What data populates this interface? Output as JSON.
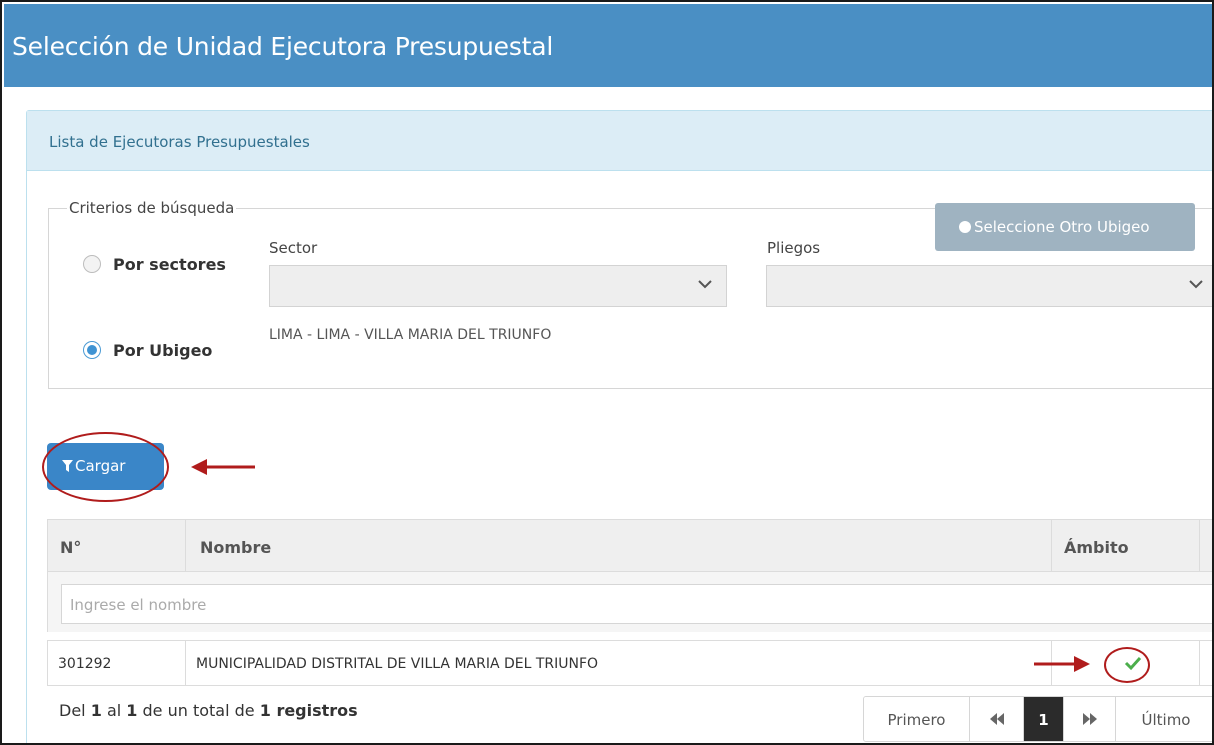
{
  "window": {
    "title": "Selección de Unidad Ejecutora Presupuestal"
  },
  "panel": {
    "heading": "Lista de Ejecutoras Presupuestales"
  },
  "criteria": {
    "legend": "Criterios de búsqueda",
    "option_sectores": "Por sectores",
    "option_ubigeo": "Por Ubigeo",
    "selected_option": "Por Ubigeo",
    "sector_label": "Sector",
    "sector_value": "",
    "pliegos_label": "Pliegos",
    "pliegos_value": "",
    "ubigeo_value": "LIMA - LIMA - VILLA MARIA DEL TRIUNFO",
    "otro_ubigeo_button": "Seleccione Otro Ubigeo"
  },
  "actions": {
    "cargar_button": "Cargar"
  },
  "table": {
    "columns": [
      "N°",
      "Nombre",
      "Ámbito"
    ],
    "filter_placeholder": "Ingrese el nombre",
    "rows": [
      {
        "numero": "301292",
        "nombre": "MUNICIPALIDAD DISTRITAL DE VILLA MARIA DEL TRIUNFO",
        "ambito_selected": true
      }
    ]
  },
  "summary": {
    "prefix": "Del",
    "from": "1",
    "mid1": "al",
    "to": "1",
    "mid2": "de un total de",
    "total": "1 registros"
  },
  "pagination": {
    "first": "Primero",
    "prev_icon": "fast-backward-icon",
    "current_page": "1",
    "next_icon": "fast-forward-icon",
    "last": "Último"
  },
  "colors": {
    "title_bar": "#4a8fc4",
    "primary_button": "#3a86c8",
    "disabled_button": "#9fb3c1",
    "annotation_red": "#b01c1c",
    "check_green": "#4cae4c"
  }
}
